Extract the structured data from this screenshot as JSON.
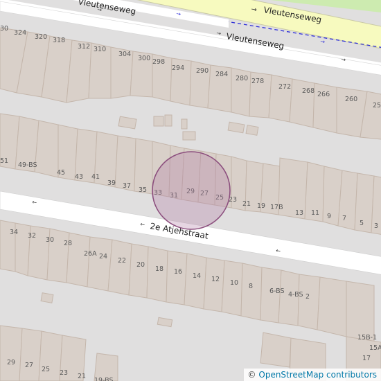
{
  "map": {
    "streets": [
      {
        "id": "vleutenseweg-main",
        "label": "Vleutenseweg"
      },
      {
        "id": "vleutenseweg-side",
        "label": "Vleutenseweg"
      },
      {
        "id": "vleutenseweg-top",
        "label": "Vleutenseweg"
      },
      {
        "id": "atjehstraat",
        "label": "2e Atjehstraat"
      }
    ],
    "house_numbers": [
      "30",
      "324",
      "320",
      "318",
      "312",
      "310",
      "304",
      "300",
      "298",
      "294",
      "290",
      "284",
      "280",
      "278",
      "272",
      "268",
      "266",
      "260",
      "25",
      "51",
      "49-BS",
      "45",
      "43",
      "41",
      "39",
      "37",
      "35",
      "33",
      "31",
      "29",
      "27",
      "25",
      "23",
      "21",
      "19",
      "17B",
      "13",
      "11",
      "9",
      "7",
      "5",
      "3",
      "34",
      "32",
      "30",
      "28",
      "26A",
      "24",
      "22",
      "20",
      "18",
      "16",
      "14",
      "12",
      "10",
      "8",
      "6-BS",
      "4-BS",
      "2",
      "29",
      "27",
      "25",
      "23",
      "21",
      "19-BS",
      "15B-1",
      "15A",
      "17"
    ],
    "marker": {
      "color": "#b27ca6",
      "shape": "circle"
    },
    "colors": {
      "background": "#e0dfdf",
      "building": "#d9d0c9",
      "building_stroke": "#c4b6ab",
      "road": "#ffffff",
      "primary_road": "#f7fabf",
      "cycleway": "#0000ff",
      "park": "#cdebb0"
    }
  },
  "attribution": {
    "copyright": "©",
    "text": "OpenStreetMap contributors"
  }
}
